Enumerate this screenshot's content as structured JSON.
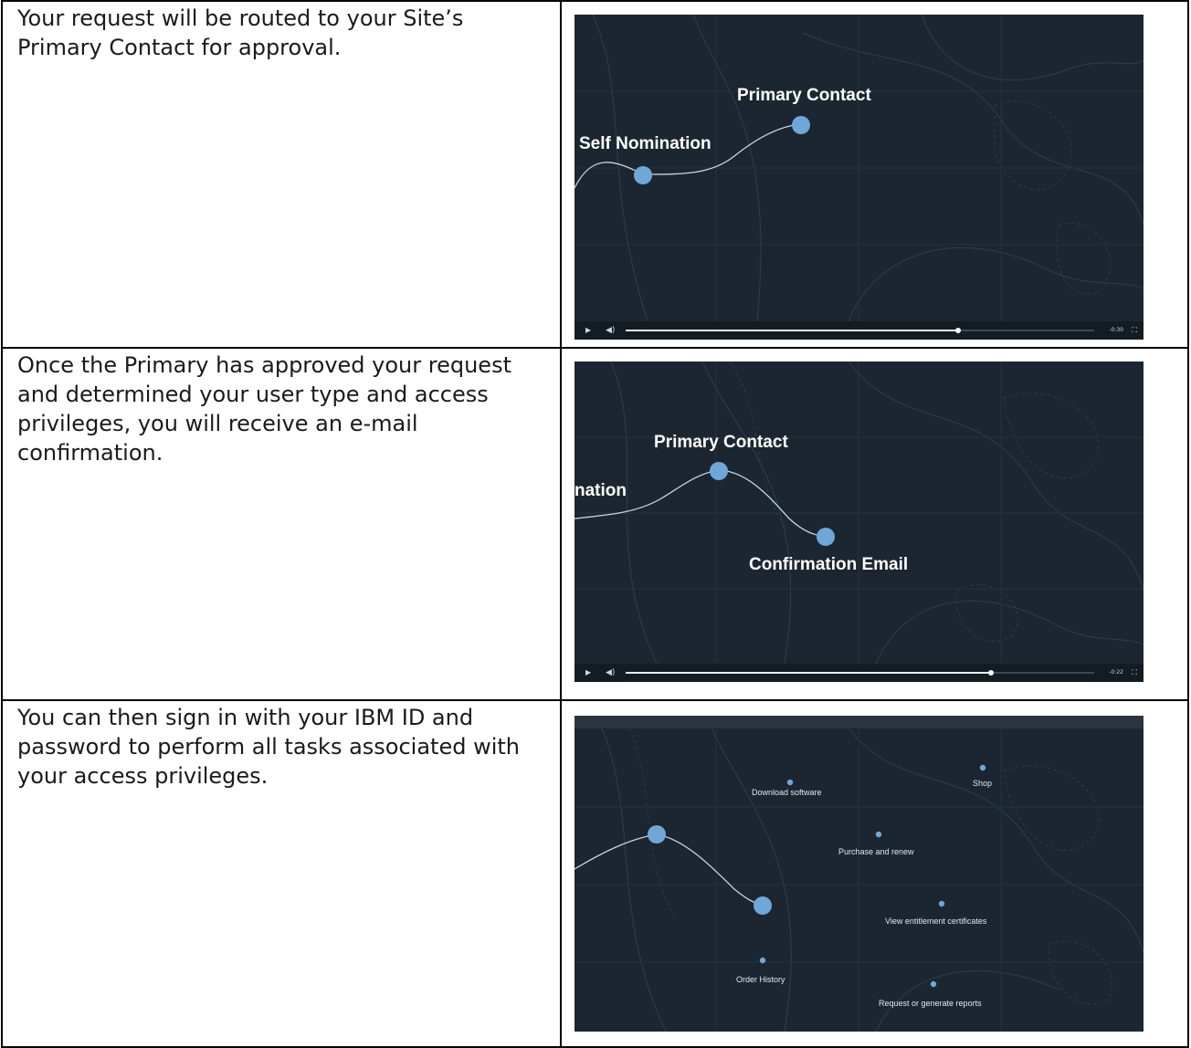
{
  "rows": [
    {
      "text": "Your request will be routed to your Site’s Primary Contact for approval.",
      "video": {
        "labels": {
          "primary": "Primary Contact",
          "self": "Self Nomination"
        },
        "controls": {
          "progress": 0.71,
          "time": "-0:30"
        }
      }
    },
    {
      "text": "Once the Primary has approved your request and determined your user type and access privileges, you will receive an e-mail confirmation.",
      "video": {
        "labels": {
          "primary": "Primary Contact",
          "self": "nation",
          "confirm": "Confirmation Email"
        },
        "controls": {
          "progress": 0.78,
          "time": "-0:22"
        }
      }
    },
    {
      "text": "You can then sign in with your IBM ID and password to perform all tasks associated with your access privileges.",
      "video": {
        "labels": {
          "download": "Download software",
          "shop": "Shop",
          "purchase": "Purchase and renew",
          "certificates": "View entitlement certificates",
          "history": "Order History",
          "reports": "Request or generate reports"
        }
      }
    }
  ],
  "colors": {
    "background": "#1b2630",
    "node": "#6ea7d8",
    "controls": "#141c23"
  },
  "icons": [
    "play-icon",
    "volume-icon",
    "fullscreen-icon"
  ]
}
